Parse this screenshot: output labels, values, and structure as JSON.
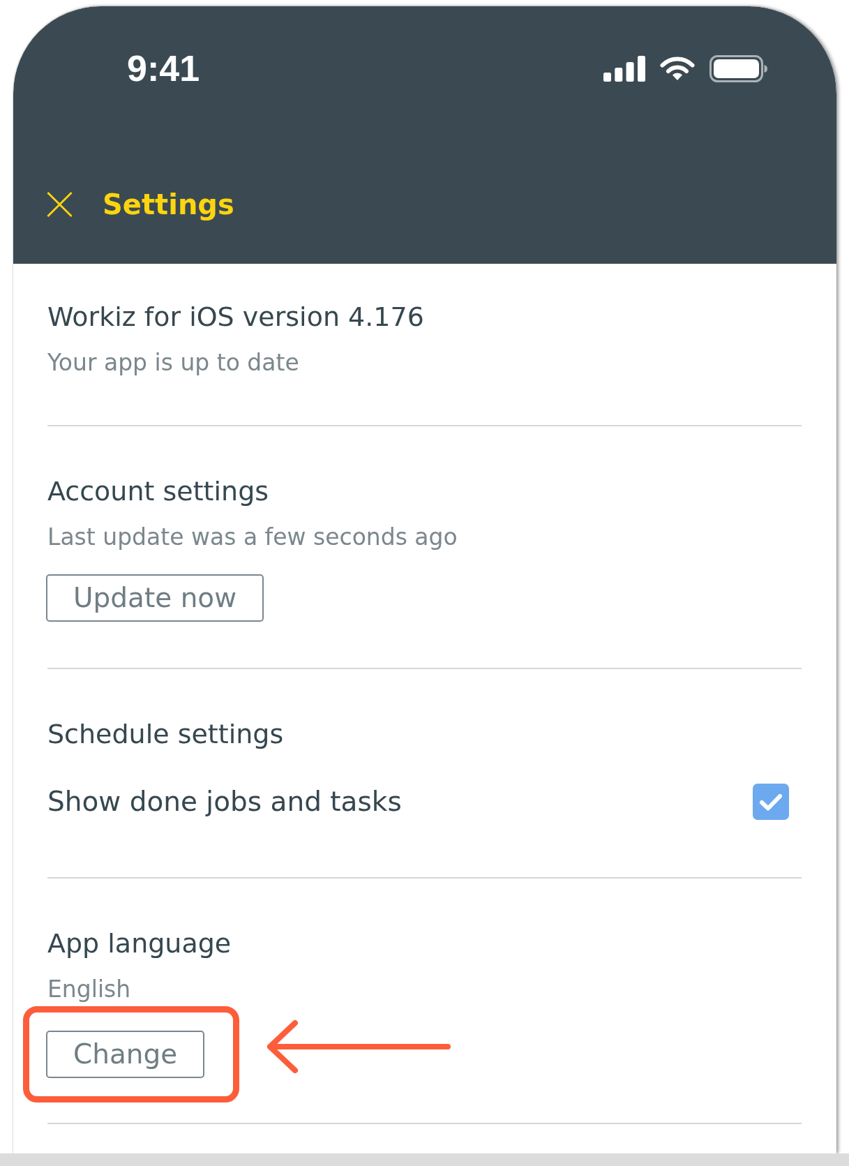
{
  "status_bar": {
    "time": "9:41"
  },
  "header": {
    "title": "Settings"
  },
  "sections": [
    {
      "kind": "info",
      "title": "Workiz for iOS version 4.176",
      "subtitle": "Your app is up to date"
    },
    {
      "kind": "action",
      "title": "Account settings",
      "subtitle": "Last update was a few seconds ago",
      "button": "Update now",
      "highlighted": false
    },
    {
      "kind": "toggle",
      "title": "Schedule settings",
      "option": {
        "label": "Show done jobs and tasks",
        "checked": true
      }
    },
    {
      "kind": "action",
      "title": "App language",
      "subtitle": "English",
      "button": "Change",
      "highlighted": true
    }
  ]
}
